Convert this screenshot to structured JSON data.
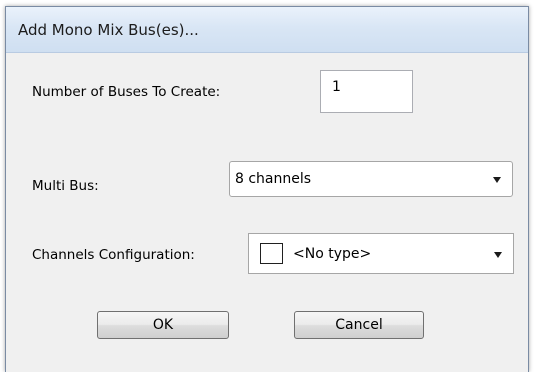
{
  "window": {
    "title": "Add Mono Mix Bus(es)..."
  },
  "fields": {
    "num_buses_label": "Number of Buses To Create:",
    "num_buses_value": "1",
    "multi_bus_label": "Multi Bus:",
    "multi_bus_value": "8 channels",
    "channels_config_label": "Channels Configuration:",
    "channels_config_value": "<No type>"
  },
  "buttons": {
    "ok_label": "OK",
    "cancel_label": "Cancel"
  },
  "colors": {
    "titlebar": "#d9e6f5",
    "dialog_bg": "#f0f0f0"
  }
}
